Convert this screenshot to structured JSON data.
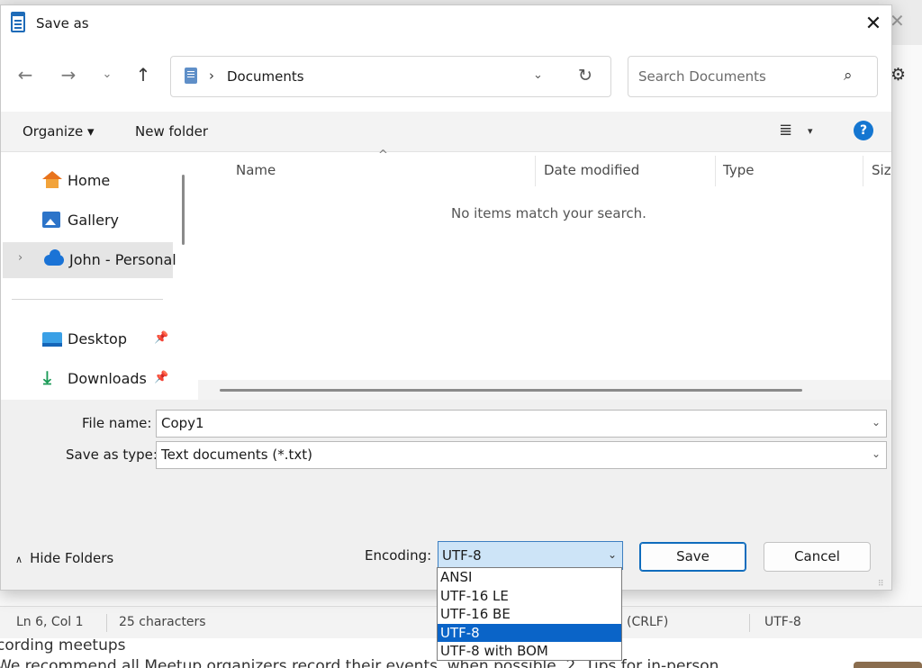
{
  "dialog": {
    "title": "Save as",
    "close_glyph": "✕"
  },
  "nav": {
    "back_glyph": "←",
    "forward_glyph": "→",
    "recent_glyph": "⌄",
    "up_glyph": "↑",
    "address": {
      "separator": "›",
      "crumb": "Documents",
      "dropdown_glyph": "⌄",
      "refresh_glyph": "↻"
    },
    "search_placeholder": "Search Documents",
    "search_glyph": "⌕"
  },
  "cmdbar": {
    "organize": "Organize ▾",
    "new_folder": "New folder",
    "view_glyph": "≣",
    "view_caret": "▾",
    "help_glyph": "?"
  },
  "sidebar": {
    "items": [
      {
        "label": "Home",
        "icon": "home-icon"
      },
      {
        "label": "Gallery",
        "icon": "gallery-icon"
      },
      {
        "label": "John - Personal",
        "icon": "onedrive-icon",
        "expander": "›",
        "selected": true
      },
      {
        "label": "Desktop",
        "icon": "desktop-icon",
        "pinned": true
      },
      {
        "label": "Downloads",
        "icon": "download-icon",
        "pinned": true
      }
    ],
    "pin_glyph": "📌",
    "download_glyph": "⤓"
  },
  "file_list": {
    "columns": [
      "Name",
      "Date modified",
      "Type",
      "Size"
    ],
    "sort_glyph": "^",
    "empty_message": "No items match your search."
  },
  "form": {
    "file_name_label": "File name:",
    "file_name_value": "Copy1",
    "type_label": "Save as type:",
    "type_value": "Text documents (*.txt)",
    "chevron": "⌄"
  },
  "footer": {
    "hide_folders": "Hide Folders",
    "hide_caret": "∧",
    "encoding_label": "Encoding:",
    "encoding_value": "UTF-8",
    "encoding_options": [
      "ANSI",
      "UTF-16 LE",
      "UTF-16 BE",
      "UTF-8",
      "UTF-8 with BOM"
    ],
    "encoding_selected_index": 3,
    "save": "Save",
    "cancel": "Cancel",
    "grip": "⠿"
  },
  "background": {
    "close_glyph": "✕",
    "gear_glyph": "⚙",
    "status": {
      "position": "Ln 6, Col 1",
      "characters": "25 characters",
      "line_ending": "(CRLF)",
      "encoding": "UTF-8"
    },
    "text_line1": "cording meetups",
    "text_line2": "We recommend all Meetup organizers record their events, when possible. 2. Tips for in-person"
  },
  "colors": {
    "accent": "#0f6cbd",
    "selection": "#0a64c8",
    "help": "#1476d1"
  }
}
